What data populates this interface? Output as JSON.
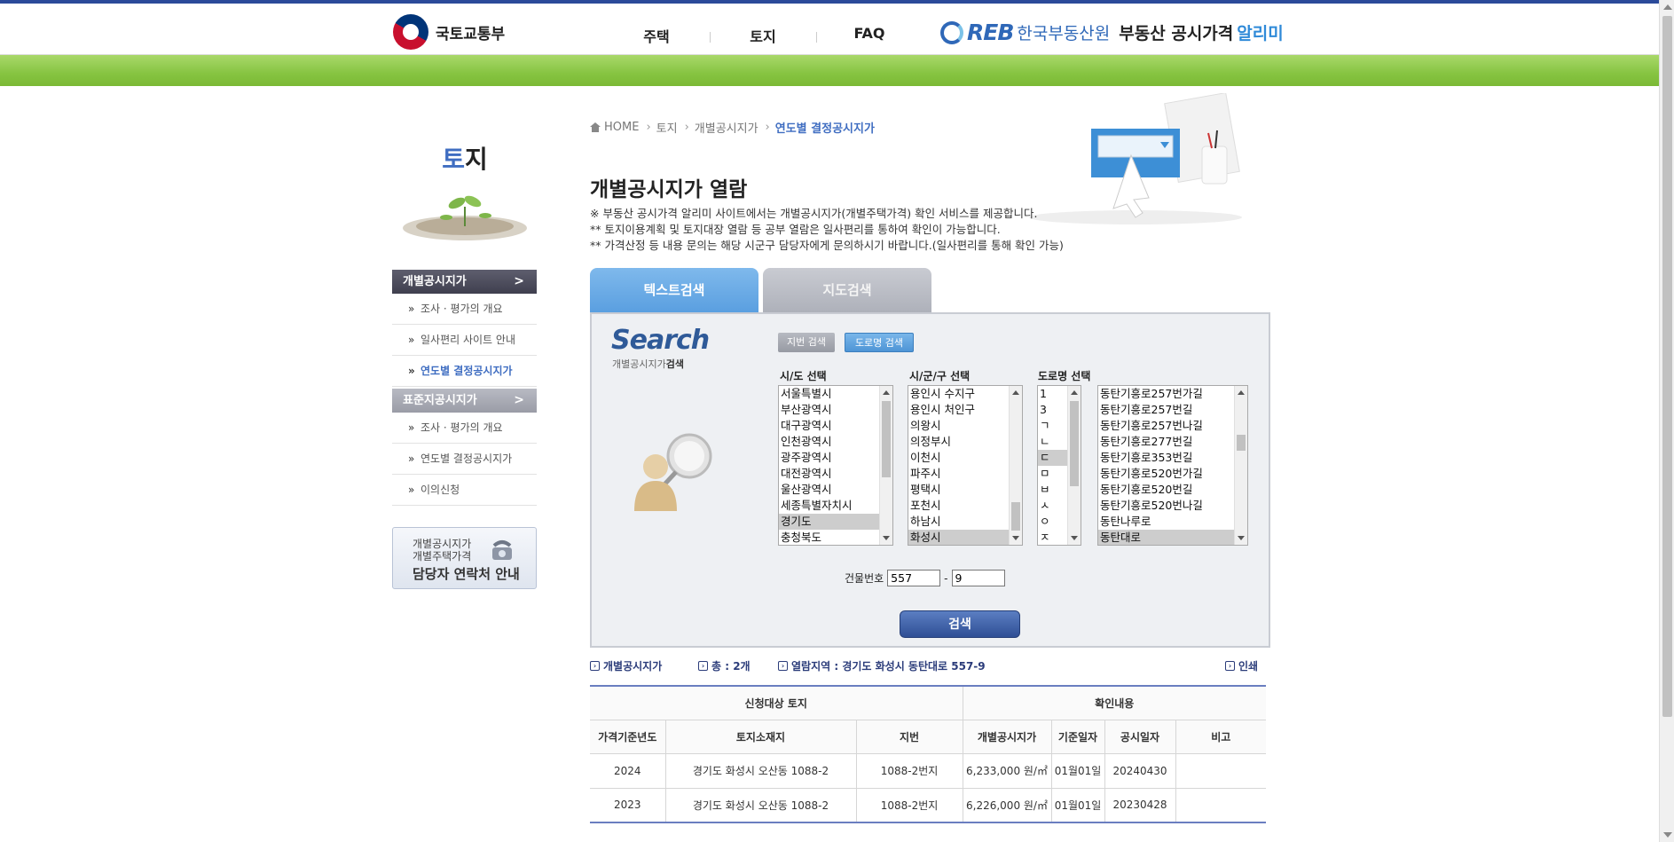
{
  "header": {
    "ministry": "국토교통부",
    "nav": [
      "주택",
      "토지",
      "FAQ"
    ],
    "reb": "REB",
    "kab": "한국부동산원",
    "alimi_a": "부동산 공시가격",
    "alimi_b": "알리미"
  },
  "sidebar": {
    "title_hl": "토",
    "title_rest": "지",
    "section1": "개별공시지가",
    "section1_items": [
      "조사 · 평가의 개요",
      "일사편리 사이트 안내",
      "연도별 결정공시지가"
    ],
    "section2": "표준지공시지가",
    "section2_items": [
      "조사 · 평가의 개요",
      "연도별 결정공시지가",
      "이의신청"
    ],
    "contact_l1": "개별공시지가",
    "contact_l2": "개별주택가격",
    "contact_l3": "담당자 연락처 안내"
  },
  "breadcrumb": [
    "HOME",
    "토지",
    "개별공시지가",
    "연도별 결정공시지가"
  ],
  "page_title": "개별공시지가 열람",
  "notices": [
    "※ 부동산 공시가격 알리미 사이트에서는 개별공시지가(개별주택가격) 확인 서비스를 제공합니다.",
    "** 토지이용계획 및 토지대장 열람 등 공부 열람은 일사편리를 통하여 확인이 가능합니다.",
    "** 가격산정 등 내용 문의는 해당 시군구 담당자에게 문의하시기 바랍니다.(일사편리를 통해 확인 가능)"
  ],
  "tabs": [
    "텍스트검색",
    "지도검색"
  ],
  "search": {
    "word": "Search",
    "sub_a": "개별공시지가",
    "sub_b": "검색",
    "mode_lot": "지번 검색",
    "mode_road": "도로명 검색",
    "label_sido": "시/도 선택",
    "label_sigungu": "시/군/구 선택",
    "label_road": "도로명 선택",
    "sido_options": [
      "서울특별시",
      "부산광역시",
      "대구광역시",
      "인천광역시",
      "광주광역시",
      "대전광역시",
      "울산광역시",
      "세종특별자치시",
      "경기도",
      "충청북도"
    ],
    "sido_selected": "경기도",
    "sigungu_options": [
      "용인시 수지구",
      "용인시 처인구",
      "의왕시",
      "의정부시",
      "이천시",
      "파주시",
      "평택시",
      "포천시",
      "하남시",
      "화성시"
    ],
    "sigungu_selected": "화성시",
    "initial_options": [
      "1",
      "3",
      "ㄱ",
      "ㄴ",
      "ㄷ",
      "ㅁ",
      "ㅂ",
      "ㅅ",
      "ㅇ",
      "ㅈ"
    ],
    "initial_selected": "ㄷ",
    "road_options": [
      "동탄기흥로257번가길",
      "동탄기흥로257번길",
      "동탄기흥로257번나길",
      "동탄기흥로277번길",
      "동탄기흥로353번길",
      "동탄기흥로520번가길",
      "동탄기흥로520번길",
      "동탄기흥로520번나길",
      "동탄나루로",
      "동탄대로"
    ],
    "road_selected": "동탄대로",
    "bldg_label": "건물번호",
    "bldg_main": "557",
    "bldg_dash": "-",
    "bldg_sub": "9",
    "submit": "검색"
  },
  "result": {
    "label": "개별공시지가",
    "total": "총 : 2개",
    "region": "열람지역 : 경기도 화성시 동탄대로 557-9",
    "print": "인쇄"
  },
  "table": {
    "group1": "신청대상 토지",
    "group2": "확인내용",
    "headers": [
      "가격기준년도",
      "토지소재지",
      "지번",
      "개별공시지가",
      "기준일자",
      "공시일자",
      "비고"
    ],
    "rows": [
      [
        "2024",
        "경기도 화성시 오산동 1088-2",
        "1088-2번지",
        "6,233,000 원/㎡",
        "01월01일",
        "20240430",
        ""
      ],
      [
        "2023",
        "경기도 화성시 오산동 1088-2",
        "1088-2번지",
        "6,226,000 원/㎡",
        "01월01일",
        "20230428",
        ""
      ]
    ]
  },
  "colors": {
    "accent": "#3f6dc1",
    "green": "#86c441",
    "tab_active": "#5a9fe0"
  },
  "icons": [
    "taeguk-logo-icon",
    "reb-logo-icon",
    "home-icon",
    "plant-icon",
    "phone-icon",
    "search-person-icon",
    "hero-search-icon"
  ]
}
